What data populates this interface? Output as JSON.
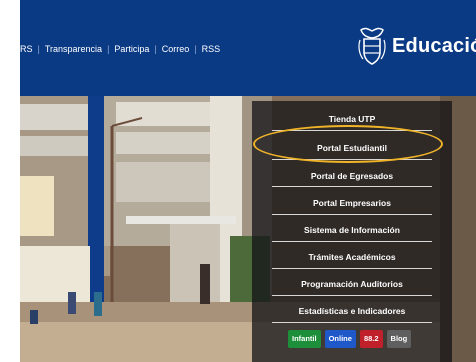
{
  "top_links": [
    "RS",
    "Transparencia",
    "Participa",
    "Correo",
    "RSS"
  ],
  "brand": {
    "text": "Educación"
  },
  "menu": [
    "Tienda UTP",
    "Portal Estudiantil",
    "Portal de Egresados",
    "Portal Empresarios",
    "Sistema de Información",
    "Trámites Académicos",
    "Programación Auditorios",
    "Estadísticas e Indicadores"
  ],
  "highlighted_item": "Portal Estudiantil",
  "tags": [
    {
      "label": "Infantil",
      "color": "#1d8f3a"
    },
    {
      "label": "Online",
      "color": "#1e58c9"
    },
    {
      "label": "88.2",
      "color": "#c0202a"
    },
    {
      "label": "Blog",
      "color": "#5f5f5f"
    }
  ],
  "colors": {
    "header": "#0b3a85",
    "highlight": "#f0b428"
  }
}
